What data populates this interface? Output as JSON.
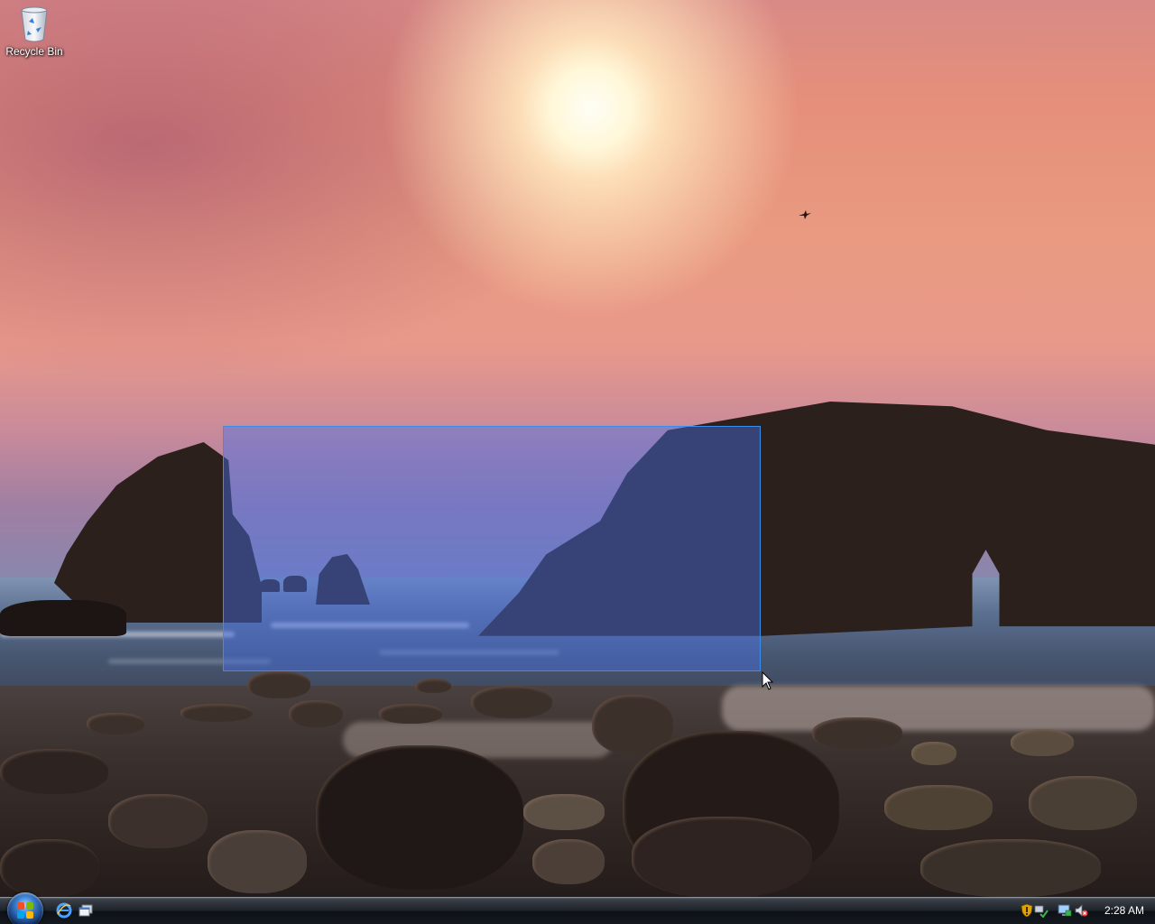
{
  "desktop": {
    "icons": [
      {
        "label": "Recycle Bin",
        "icon": "recycle-bin-icon"
      }
    ],
    "selection_rectangle": {
      "visible": true,
      "color": "#3a8ee8"
    }
  },
  "taskbar": {
    "start_button": {
      "icon": "windows-start-orb-icon"
    },
    "quick_launch": [
      {
        "icon": "internet-explorer-icon"
      },
      {
        "icon": "switch-windows-icon"
      }
    ],
    "tray_icons": [
      {
        "icon": "windows-security-alert-icon"
      },
      {
        "icon": "network-icon"
      },
      {
        "icon": "display-icon"
      },
      {
        "icon": "volume-muted-icon"
      }
    ],
    "clock": "2:28 AM"
  },
  "colors": {
    "selection_fill": "#466ee6",
    "taskbar": "#151a21",
    "accent": "#3a8ee8"
  }
}
